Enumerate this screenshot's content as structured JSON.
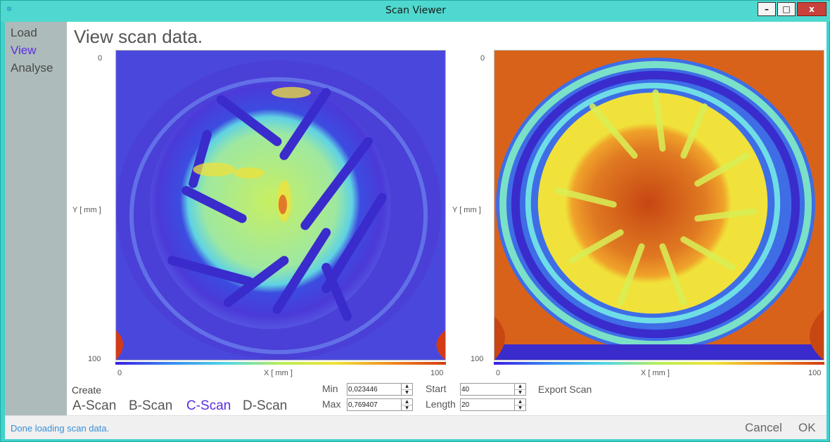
{
  "window": {
    "title": "Scan Viewer",
    "minimize": "–",
    "maximize": "□",
    "close": "x"
  },
  "sidebar": {
    "items": [
      {
        "label": "Load",
        "active": false
      },
      {
        "label": "View",
        "active": true
      },
      {
        "label": "Analyse",
        "active": false
      }
    ]
  },
  "main": {
    "heading": "View scan data.",
    "plots": [
      {
        "y_top": "0",
        "y_bottom": "100",
        "y_label": "Y [ mm ]",
        "x_left": "0",
        "x_right": "100",
        "x_label": "X [ mm ]",
        "colormap": "rainbow",
        "scan": "blue-dominant C-scan"
      },
      {
        "y_top": "0",
        "y_bottom": "100",
        "y_label": "Y [ mm ]",
        "x_left": "0",
        "x_right": "100",
        "x_label": "X [ mm ]",
        "colormap": "rainbow",
        "scan": "red-dominant C-scan"
      }
    ]
  },
  "controls": {
    "create_label": "Create",
    "scan_buttons": [
      "A-Scan",
      "B-Scan",
      "C-Scan",
      "D-Scan"
    ],
    "active_scan": "C-Scan",
    "min_label": "Min",
    "min_value": "0,023446",
    "max_label": "Max",
    "max_value": "0,769407",
    "start_label": "Start",
    "start_value": "40",
    "length_label": "Length",
    "length_value": "20",
    "export_label": "Export Scan"
  },
  "footer": {
    "status": "Done loading scan data.",
    "cancel": "Cancel",
    "ok": "OK"
  },
  "colors": {
    "accent": "#5a2ee0",
    "status": "#3a8fd6",
    "frame": "#3ed3cb",
    "close": "#c9423a"
  }
}
